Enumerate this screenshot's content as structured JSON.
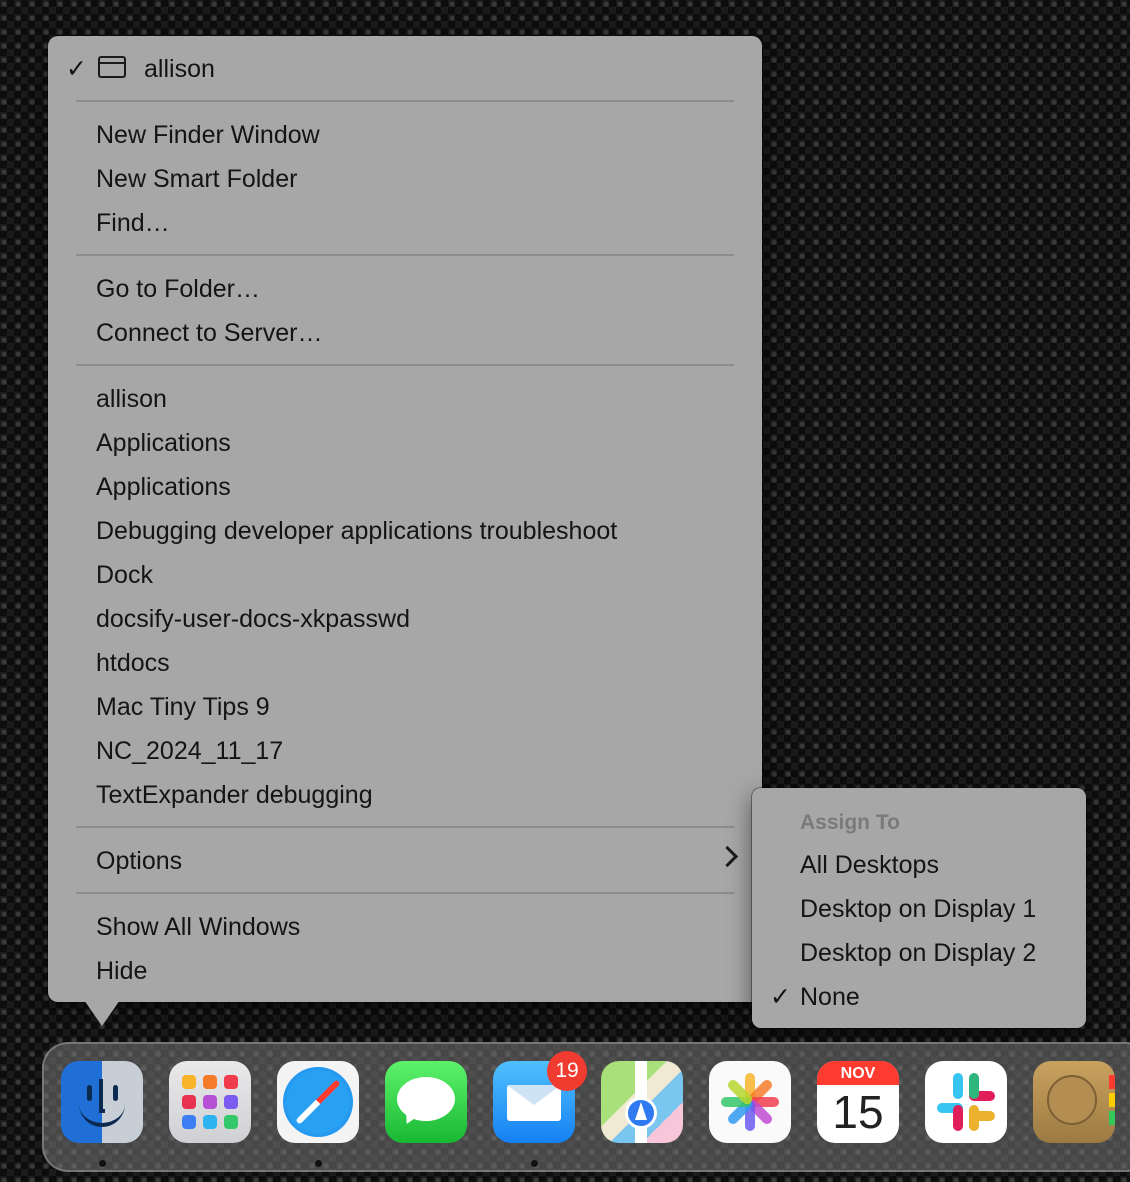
{
  "menu": {
    "current_window": "allison",
    "group_new": [
      "New Finder Window",
      "New Smart Folder",
      "Find…"
    ],
    "group_go": [
      "Go to Folder…",
      "Connect to Server…"
    ],
    "windows": [
      "allison",
      "Applications",
      "Applications",
      "Debugging developer applications troubleshoot",
      "Dock",
      "docsify-user-docs-xkpasswd",
      "htdocs",
      "Mac Tiny Tips 9",
      "NC_2024_11_17",
      "TextExpander debugging"
    ],
    "options": "Options",
    "show_all_windows": "Show All Windows",
    "hide": "Hide"
  },
  "submenu": {
    "header": "Assign To",
    "items": [
      "All Desktops",
      "Desktop on Display 1",
      "Desktop on Display 2",
      "None"
    ],
    "checked": "None"
  },
  "dock": {
    "mail_badge": "19",
    "calendar_month": "NOV",
    "calendar_day": "15",
    "apps": [
      "finder-icon",
      "launchpad-icon",
      "safari-icon",
      "messages-icon",
      "mail-icon",
      "maps-icon",
      "photos-icon",
      "calendar-icon",
      "slack-icon",
      "contacts-icon"
    ]
  }
}
